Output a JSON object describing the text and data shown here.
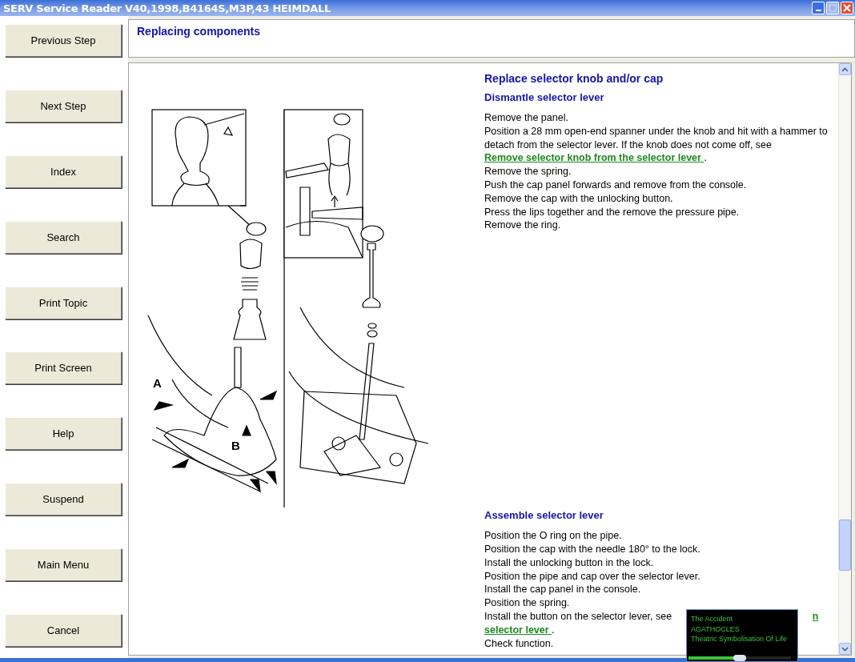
{
  "window": {
    "title": "SERV Service Reader V40,1998,B4164S,M3P,43 HEIMDALL"
  },
  "sidebar": {
    "buttons": [
      "Previous Step",
      "Next Step",
      "Index",
      "Search",
      "Print Topic",
      "Print Screen",
      "Help",
      "Suspend",
      "Main Menu",
      "Cancel"
    ]
  },
  "header": {
    "title": "Replacing components"
  },
  "illustration": {
    "labels": [
      "A",
      "B"
    ]
  },
  "content": {
    "title": "Replace selector knob and/or cap",
    "sections": [
      {
        "heading": "Dismantle selector lever",
        "steps": [
          {
            "parts": [
              {
                "kind": "text",
                "text": "Remove the panel."
              }
            ]
          },
          {
            "parts": [
              {
                "kind": "text",
                "text": "Position a 28 mm open-end spanner under the knob and hit with a hammer to detach from the selector lever. If the knob does not come off, see "
              },
              {
                "kind": "link",
                "text": "Remove selector knob from the selector lever "
              },
              {
                "kind": "text",
                "text": "."
              }
            ]
          },
          {
            "parts": [
              {
                "kind": "text",
                "text": "Remove the spring."
              }
            ]
          },
          {
            "parts": [
              {
                "kind": "text",
                "text": "Push the cap panel forwards and remove from the console."
              }
            ]
          },
          {
            "parts": [
              {
                "kind": "text",
                "text": "Remove the cap with the unlocking button."
              }
            ]
          },
          {
            "parts": [
              {
                "kind": "text",
                "text": "Press the lips together and the remove the pressure pipe."
              }
            ]
          },
          {
            "parts": [
              {
                "kind": "text",
                "text": "Remove the ring."
              }
            ]
          }
        ]
      },
      {
        "heading": "Assemble selector lever",
        "steps": [
          {
            "parts": [
              {
                "kind": "text",
                "text": "Position the O ring on the pipe."
              }
            ]
          },
          {
            "parts": [
              {
                "kind": "text",
                "text": "Position the cap with the needle 180° to the lock."
              }
            ]
          },
          {
            "parts": [
              {
                "kind": "text",
                "text": "Install the unlocking button in the lock."
              }
            ]
          },
          {
            "parts": [
              {
                "kind": "text",
                "text": "Position the pipe and cap over the selector lever."
              }
            ]
          },
          {
            "parts": [
              {
                "kind": "text",
                "text": "Install the cap panel in the console."
              }
            ]
          },
          {
            "parts": [
              {
                "kind": "text",
                "text": "Position the spring."
              }
            ]
          },
          {
            "obscured": true,
            "parts": [
              {
                "kind": "text",
                "text": "Install the button on the selector lever, see "
              },
              {
                "kind": "link",
                "text": "n"
              },
              {
                "kind": "link",
                "text": "selector lever "
              },
              {
                "kind": "text",
                "text": "."
              }
            ]
          },
          {
            "parts": [
              {
                "kind": "text",
                "text": "Check function."
              }
            ]
          }
        ]
      }
    ]
  },
  "media_popup": {
    "lines": [
      "The Accident",
      "AGATHOCLES",
      "Theatric Symbolisation Of Life"
    ],
    "level": 0.5
  }
}
